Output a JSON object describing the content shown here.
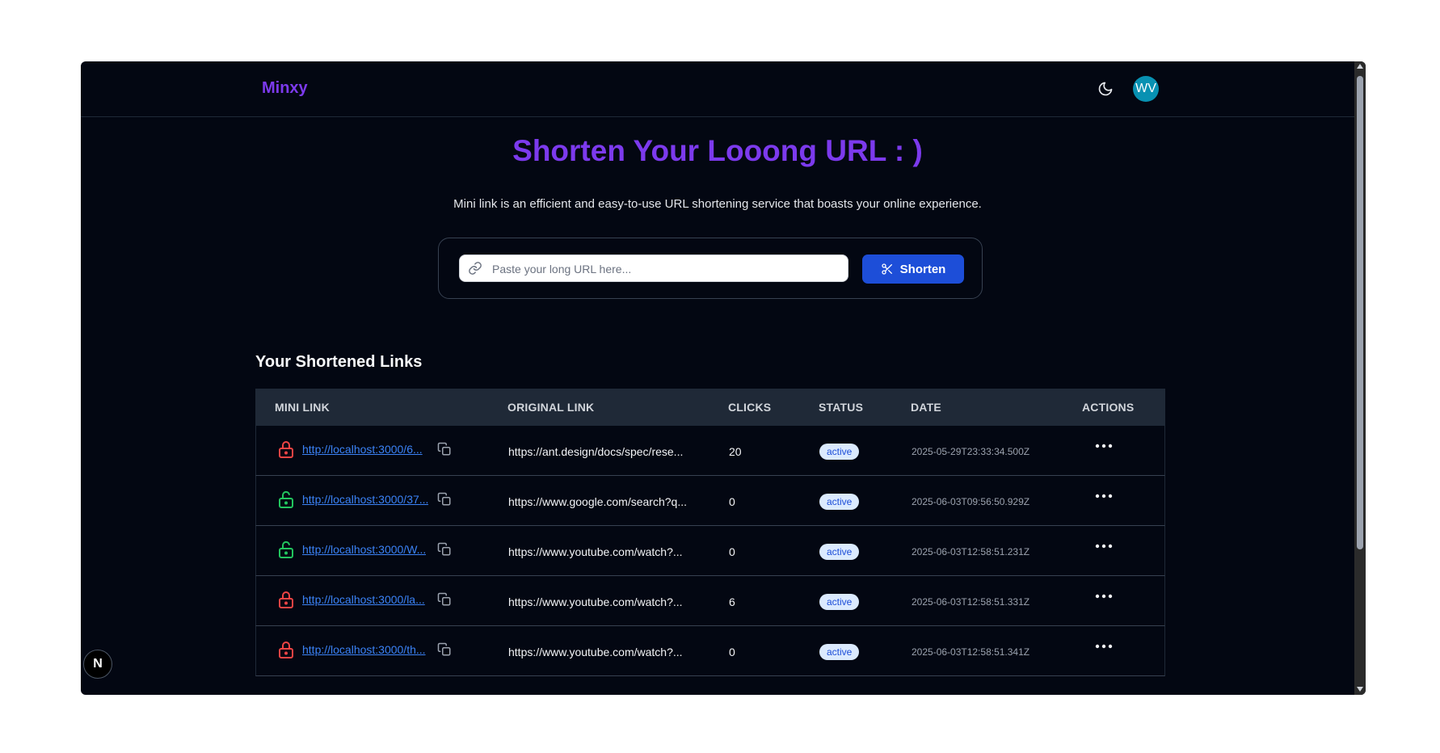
{
  "nav": {
    "logo": "Minxy",
    "avatar_initials": "WV"
  },
  "hero": {
    "title": "Shorten Your Looong URL : )",
    "subtitle": "Mini link is an efficient and easy-to-use URL shortening service that boasts your online experience."
  },
  "form": {
    "placeholder": "Paste your long URL here...",
    "value": "",
    "button_label": "Shorten"
  },
  "links_section": {
    "title": "Your Shortened Links",
    "columns": [
      "MINI LINK",
      "ORIGINAL LINK",
      "CLICKS",
      "STATUS",
      "DATE",
      "ACTIONS"
    ],
    "rows": [
      {
        "locked": true,
        "mini_link": "http://localhost:3000/6...",
        "original": "https://ant.design/docs/spec/rese...",
        "clicks": "20",
        "status": "active",
        "date": "2025-05-29T23:33:34.500Z"
      },
      {
        "locked": false,
        "mini_link": "http://localhost:3000/37...",
        "original": "https://www.google.com/search?q...",
        "clicks": "0",
        "status": "active",
        "date": "2025-06-03T09:56:50.929Z"
      },
      {
        "locked": false,
        "mini_link": "http://localhost:3000/W...",
        "original": "https://www.youtube.com/watch?...",
        "clicks": "0",
        "status": "active",
        "date": "2025-06-03T12:58:51.231Z"
      },
      {
        "locked": true,
        "mini_link": "http://localhost:3000/la...",
        "original": "https://www.youtube.com/watch?...",
        "clicks": "6",
        "status": "active",
        "date": "2025-06-03T12:58:51.331Z"
      },
      {
        "locked": true,
        "mini_link": "http://localhost:3000/th...",
        "original": "https://www.youtube.com/watch?...",
        "clicks": "0",
        "status": "active",
        "date": "2025-06-03T12:58:51.341Z"
      }
    ]
  },
  "colors": {
    "brand": "#7c3aed",
    "primary_button": "#1d4ed8",
    "locked": "#ef4444",
    "unlocked": "#22c55e",
    "link": "#3b82f6",
    "background": "#030712"
  },
  "icons": {
    "theme_toggle": "moon-icon",
    "input": "link-icon",
    "shorten": "scissors-icon",
    "locked": "lock-closed-icon",
    "unlocked": "lock-open-icon",
    "copy": "copy-icon",
    "actions": "ellipsis-icon",
    "dev_badge": "nextjs-icon"
  },
  "dev_badge": {
    "label": "N"
  }
}
